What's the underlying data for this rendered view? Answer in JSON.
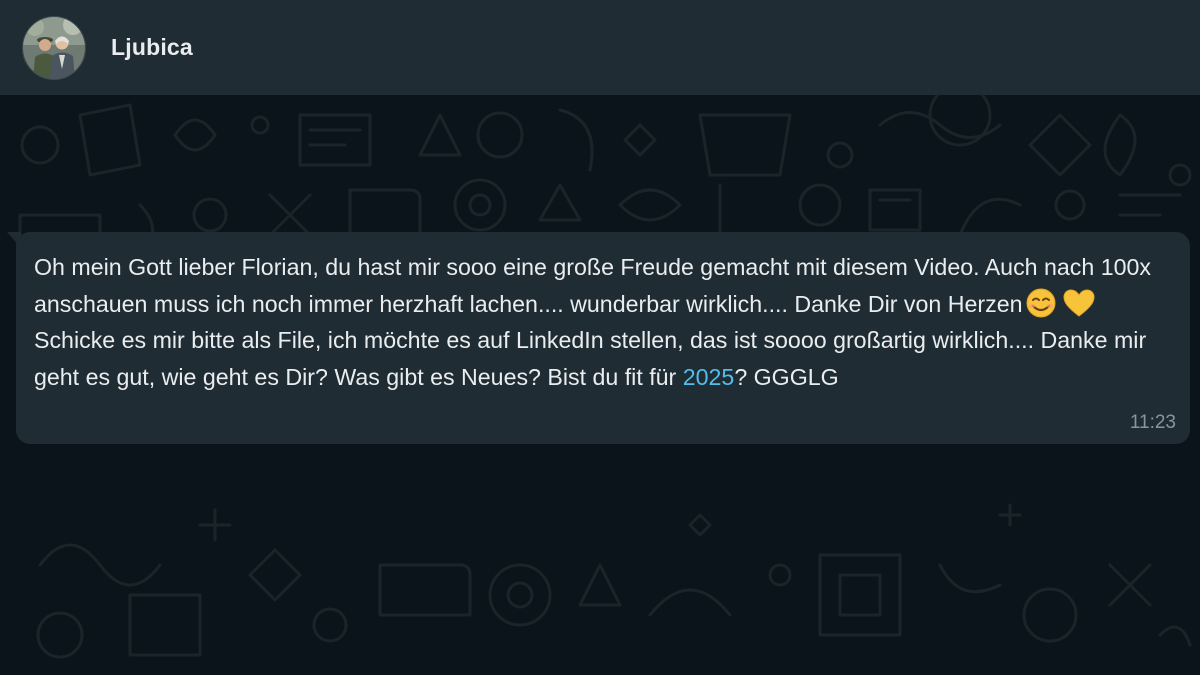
{
  "header": {
    "contact_name": "Ljubica",
    "avatar_icon": "profile-photo-icon"
  },
  "message": {
    "text_part1": "Oh mein Gott lieber Florian, du hast mir sooo eine große Freude gemacht mit diesem Video. Auch nach 100x anschauen muss ich noch immer herzhaft lachen.... wunderbar wirklich.... Danke Dir von Herzen",
    "emoji_1": "smiling-face-icon",
    "emoji_2": "yellow-heart-icon",
    "text_part2": " Schicke es mir bitte als File, ich möchte es auf LinkedIn stellen, das ist soooo großartig wirklich.... Danke mir geht es gut, wie geht es Dir? Was gibt es Neues? Bist du fit für ",
    "link_text": "2025",
    "text_part3": "? GGGLG",
    "time": "11:23"
  },
  "colors": {
    "header_bg": "#202c33",
    "chat_bg": "#0b141a",
    "bubble_bg": "#202c33",
    "text": "#e9edef",
    "link": "#53bdeb",
    "meta": "#8696a0"
  }
}
